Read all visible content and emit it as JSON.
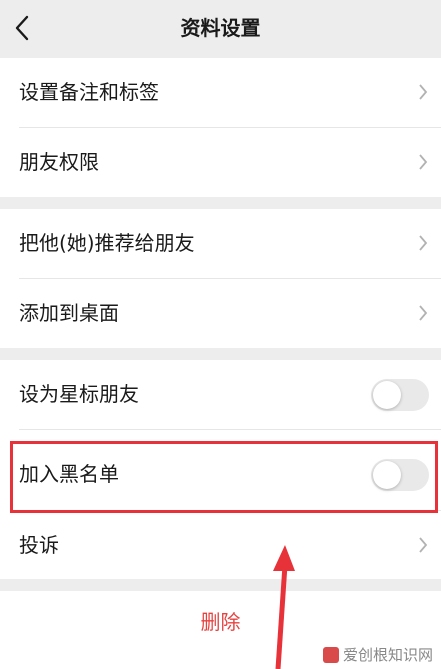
{
  "header": {
    "title": "资料设置"
  },
  "groups": [
    {
      "items": [
        {
          "label": "设置备注和标签"
        },
        {
          "label": "朋友权限"
        }
      ]
    },
    {
      "items": [
        {
          "label": "把他(她)推荐给朋友"
        },
        {
          "label": "添加到桌面"
        }
      ]
    },
    {
      "items": [
        {
          "label": "设为星标朋友",
          "toggle": false
        },
        {
          "label": "加入黑名单",
          "toggle": false
        },
        {
          "label": "投诉"
        }
      ]
    }
  ],
  "actions": {
    "delete_label": "删除"
  },
  "colors": {
    "highlight": "#e8323a",
    "delete": "#e64340",
    "background": "#ededed"
  },
  "watermark": {
    "text": "爱创根知识网"
  }
}
